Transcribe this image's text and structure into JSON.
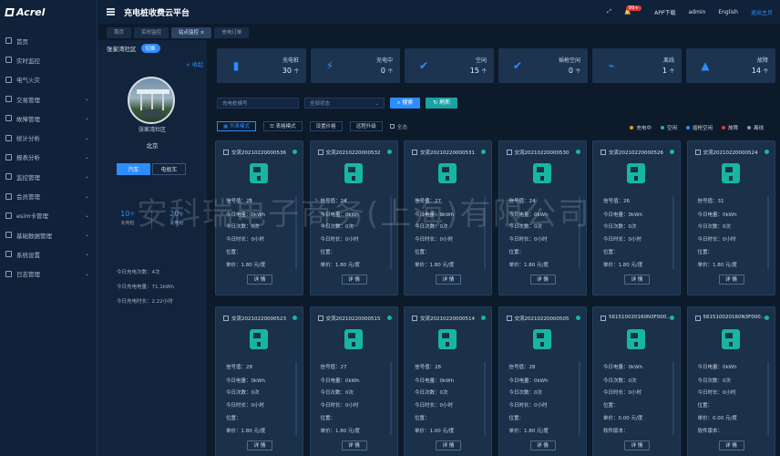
{
  "brand": "Acrel",
  "app_title": "充电桩收费云平台",
  "header": {
    "fullscreen_icon": "expand-icon",
    "notice_badge": "99+",
    "app_download": "APP下载",
    "user": "admin",
    "language": "English",
    "logout": "退出主页"
  },
  "sidebar": {
    "items": [
      {
        "label": "首页",
        "icon": "home-icon",
        "arrow": ""
      },
      {
        "label": "实时监控",
        "icon": "monitor-icon",
        "arrow": ""
      },
      {
        "label": "电气火灾",
        "icon": "fire-icon",
        "arrow": ""
      },
      {
        "label": "交易管理",
        "icon": "trade-icon",
        "arrow": "⌄"
      },
      {
        "label": "故障管理",
        "icon": "fault-icon",
        "arrow": "⌄"
      },
      {
        "label": "统计分析",
        "icon": "stats-icon",
        "arrow": "⌄"
      },
      {
        "label": "报表分析",
        "icon": "report-icon",
        "arrow": "⌄"
      },
      {
        "label": "监控管理",
        "icon": "camera-icon",
        "arrow": "⌄"
      },
      {
        "label": "会员管理",
        "icon": "member-icon",
        "arrow": "⌄"
      },
      {
        "label": "esim卡管理",
        "icon": "sim-icon",
        "arrow": "⌄"
      },
      {
        "label": "基础数据管理",
        "icon": "data-icon",
        "arrow": "⌄"
      },
      {
        "label": "系统设置",
        "icon": "settings-icon",
        "arrow": "⌄"
      },
      {
        "label": "日志管理",
        "icon": "log-icon",
        "arrow": "⌄"
      }
    ]
  },
  "tabs": [
    {
      "label": "首页",
      "active": false
    },
    {
      "label": "实时监控",
      "active": false
    },
    {
      "label": "站点监控 ×",
      "active": true
    },
    {
      "label": "充电订单",
      "active": false
    }
  ],
  "station": {
    "name": "张家湾社区",
    "switch_label": "切换",
    "collapse_label": "< 收起",
    "community": "张家湾社区",
    "city": "北京",
    "vehicle_tabs": [
      "汽车",
      "电瓶车"
    ],
    "stats": [
      {
        "value": "10",
        "unit": "个",
        "label": "充电桩"
      },
      {
        "value": "20",
        "unit": "个",
        "label": "充电枪"
      }
    ],
    "today": [
      "今日充电次数：4次",
      "今日充电电量：71.1kWh",
      "今日充电时长：2.22小时"
    ]
  },
  "summary": [
    {
      "label": "充电桩",
      "value": "30",
      "unit": "个",
      "icon": "charger-icon"
    },
    {
      "label": "充电中",
      "value": "0",
      "unit": "个",
      "icon": "bolt-icon"
    },
    {
      "label": "空闲",
      "value": "15",
      "unit": "个",
      "icon": "check-icon"
    },
    {
      "label": "插枪空闲",
      "value": "0",
      "unit": "个",
      "icon": "check-icon"
    },
    {
      "label": "离线",
      "value": "1",
      "unit": "个",
      "icon": "unplug-icon"
    },
    {
      "label": "故障",
      "value": "14",
      "unit": "个",
      "icon": "warning-icon"
    }
  ],
  "filters": {
    "search_placeholder": "充电桩编号",
    "status_select": "全部状态",
    "search_btn": "搜索",
    "refresh_btn": "刷新"
  },
  "modes": {
    "list_mode": "列表模式",
    "table_mode": "表格模式",
    "set_price": "设置价格",
    "remote_upgrade": "远程升级",
    "select_all": "全选"
  },
  "legend": [
    {
      "label": "充电中",
      "color": "#e0a020"
    },
    {
      "label": "空闲",
      "color": "#17b6a2"
    },
    {
      "label": "插枪空闲",
      "color": "#2d8cff"
    },
    {
      "label": "故障",
      "color": "#e03a3a"
    },
    {
      "label": "离线",
      "color": "#8a96a6"
    }
  ],
  "detail_label": "详 情",
  "chargers_row1": [
    {
      "id": "交流20210220000536",
      "lines": [
        "信号值：25",
        "今日电量：0kWh",
        "今日次数：0次",
        "今日时长：0小时",
        "位置：",
        "单价：1.80 元/度"
      ]
    },
    {
      "id": "交流20210220000532",
      "lines": [
        "信号值：24",
        "今日电量：0kWh",
        "今日次数：0次",
        "今日时长：0小时",
        "位置：",
        "单价：1.80 元/度"
      ]
    },
    {
      "id": "交流20210220000531",
      "lines": [
        "信号值：27",
        "今日电量：0kWh",
        "今日次数：0次",
        "今日时长：0小时",
        "位置：",
        "单价：1.80 元/度"
      ]
    },
    {
      "id": "交流20210220000530",
      "lines": [
        "信号值：24",
        "今日电量：0kWh",
        "今日次数：0次",
        "今日时长：0小时",
        "位置：",
        "单价：1.80 元/度"
      ]
    },
    {
      "id": "交流20210220000526",
      "lines": [
        "信号值：26",
        "今日电量：0kWh",
        "今日次数：0次",
        "今日时长：0小时",
        "位置：",
        "单价：1.80 元/度"
      ]
    },
    {
      "id": "交流20210220000524",
      "lines": [
        "信号值：31",
        "今日电量：0kWh",
        "今日次数：0次",
        "今日时长：0小时",
        "位置：",
        "单价：1.80 元/度"
      ]
    }
  ],
  "chargers_row2": [
    {
      "id": "交流20210220000523",
      "lines": [
        "信号值：28",
        "今日电量：0kWh",
        "今日次数：0次",
        "今日时长：0小时",
        "位置：",
        "单价：1.80 元/度"
      ]
    },
    {
      "id": "交流20210220000515",
      "lines": [
        "信号值：27",
        "今日电量：0kWh",
        "今日次数：0次",
        "今日时长：0小时",
        "位置：",
        "单价：1.80 元/度"
      ]
    },
    {
      "id": "交流20210220000514",
      "lines": [
        "信号值：28",
        "今日电量：0kWh",
        "今日次数：0次",
        "今日时长：0小时",
        "位置：",
        "单价：1.00 元/度"
      ]
    },
    {
      "id": "交流20210220000505",
      "lines": [
        "信号值：28",
        "今日电量：0kWh",
        "今日次数：0次",
        "今日时长：0小时",
        "位置：",
        "单价：1.80 元/度"
      ]
    },
    {
      "id": "561510020160N3F000...",
      "lines": [
        "今日电量：0kWh",
        "今日次数：0次",
        "今日时长：0小时",
        "位置：",
        "单价：0.00 元/度",
        "软件版本："
      ]
    },
    {
      "id": "561510020160N3F000...",
      "lines": [
        "今日电量：0kWh",
        "今日次数：0次",
        "今日时长：0小时",
        "位置：",
        "单价：0.00 元/度",
        "软件版本："
      ]
    }
  ],
  "watermark": "安科瑞电子商务(上海)有限公司"
}
